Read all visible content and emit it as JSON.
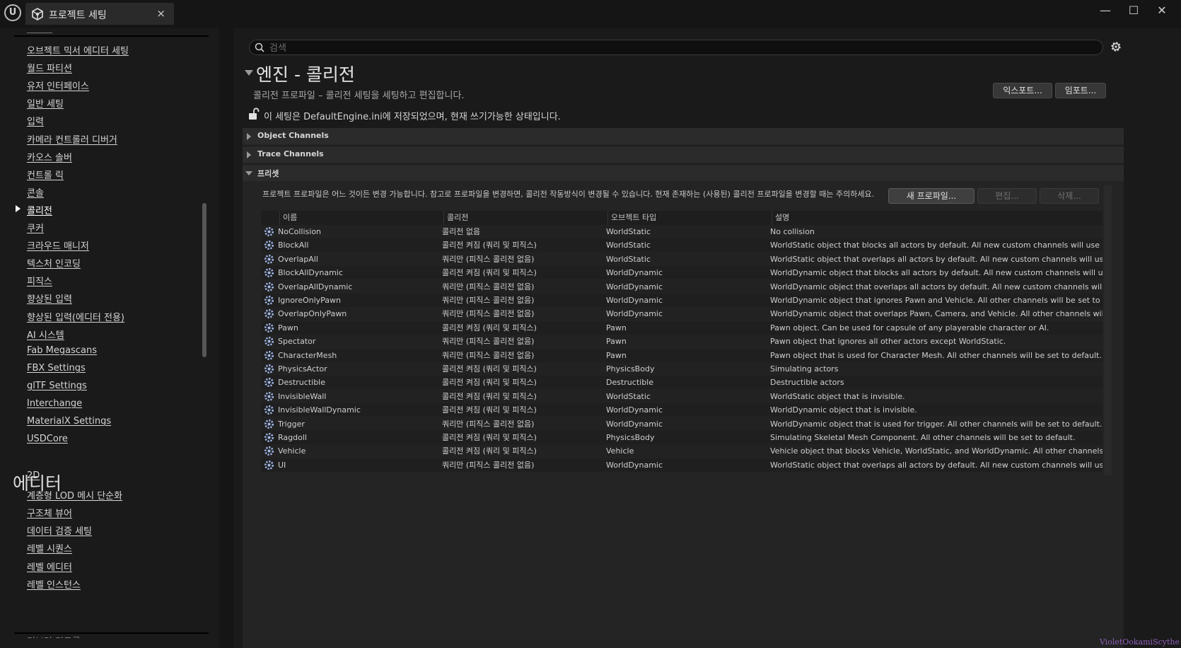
{
  "window": {
    "tab_title": "프로젝트 세팅",
    "close_glyph": "×",
    "controls": {
      "minimize": "—",
      "maximize": "☐",
      "close": "✕"
    }
  },
  "sidebar": {
    "items_top": [
      {
        "label": "오브젝트 믹서 에디터 세팅"
      },
      {
        "label": "월드 파티션"
      },
      {
        "label": "유저 인터페이스"
      },
      {
        "label": "일반 세팅"
      },
      {
        "label": "입력"
      },
      {
        "label": "카메라 컨트롤러 디버거"
      },
      {
        "label": "카오스 솔버"
      },
      {
        "label": "컨트롤 릭"
      },
      {
        "label": "콘솔"
      },
      {
        "label": "콜리전",
        "selected": true
      },
      {
        "label": "쿠커"
      },
      {
        "label": "크라우드 매니저"
      },
      {
        "label": "텍스처 인코딩"
      },
      {
        "label": "피직스"
      },
      {
        "label": "향상된 입력"
      },
      {
        "label": "향상된 입력(에디터 전용)"
      },
      {
        "label": "AI 시스템"
      },
      {
        "label": "Fab Megascans"
      },
      {
        "label": "FBX Settings"
      },
      {
        "label": "glTF Settings"
      },
      {
        "label": "Interchange"
      },
      {
        "label": "MaterialX Settings"
      },
      {
        "label": "USDCore"
      }
    ],
    "section_editor": "에디터",
    "items_editor": [
      {
        "label": "2D"
      },
      {
        "label": "계층형 LOD 메시 단순화"
      },
      {
        "label": "구조체 뷰어"
      },
      {
        "label": "데이터 검증 세팅"
      },
      {
        "label": "레벨 시퀀스"
      },
      {
        "label": "레벨 에디터"
      },
      {
        "label": "레벨 인스턴스"
      }
    ],
    "cut_item": "리브러 컨트롤"
  },
  "search": {
    "placeholder": "검색",
    "value": ""
  },
  "header": {
    "title": "엔진 - 콜리전",
    "description": "콜리전 프로파일 – 콜리전 세팅을 세팅하고 편집합니다.",
    "export_label": "익스포트...",
    "import_label": "임포트...",
    "status": "이 세팅은 DefaultEngine.ini에 저장되었으며, 현재 쓰기가능한 상태입니다."
  },
  "sections": {
    "object_channels": "Object Channels",
    "trace_channels": "Trace Channels",
    "presets": "프리셋"
  },
  "presets": {
    "description": "프로젝트 프로파일은 어느 것이든 변경 가능합니다. 참고로 프로파일을 변경하면, 콜리전 작동방식이 변경될 수 있습니다. 현재 존재하는 (사용된) 콜리전 프로파일을 변경할 때는 주의하세요.",
    "new_profile_label": "새 프로파일...",
    "edit_label": "편집...",
    "delete_label": "삭제..."
  },
  "table": {
    "columns": [
      "이름",
      "콜리전",
      "오브젝트 타입",
      "설명"
    ],
    "rows": [
      {
        "name": "NoCollision",
        "collision": "콜리전 없음",
        "type": "WorldStatic",
        "desc": "No collision"
      },
      {
        "name": "BlockAll",
        "collision": "콜리전 켜짐 (쿼리 및 피직스)",
        "type": "WorldStatic",
        "desc": "WorldStatic object that blocks all actors by default. All new custom channels will use its own default response."
      },
      {
        "name": "OverlapAll",
        "collision": "쿼리만 (피직스 콜리전 없음)",
        "type": "WorldStatic",
        "desc": "WorldStatic object that overlaps all actors by default. All new custom channels will use its own default response."
      },
      {
        "name": "BlockAllDynamic",
        "collision": "콜리전 켜짐 (쿼리 및 피직스)",
        "type": "WorldDynamic",
        "desc": "WorldDynamic object that blocks all actors by default. All new custom channels will use its own default response."
      },
      {
        "name": "OverlapAllDynamic",
        "collision": "쿼리만 (피직스 콜리전 없음)",
        "type": "WorldDynamic",
        "desc": "WorldDynamic object that overlaps all actors by default. All new custom channels will use its own default response."
      },
      {
        "name": "IgnoreOnlyPawn",
        "collision": "쿼리만 (피직스 콜리전 없음)",
        "type": "WorldDynamic",
        "desc": "WorldDynamic object that ignores Pawn and Vehicle. All other channels will be set to default."
      },
      {
        "name": "OverlapOnlyPawn",
        "collision": "쿼리만 (피직스 콜리전 없음)",
        "type": "WorldDynamic",
        "desc": "WorldDynamic object that overlaps Pawn, Camera, and Vehicle. All other channels will be set to default."
      },
      {
        "name": "Pawn",
        "collision": "콜리전 켜짐 (쿼리 및 피직스)",
        "type": "Pawn",
        "desc": "Pawn object. Can be used for capsule of any playerable character or AI."
      },
      {
        "name": "Spectator",
        "collision": "쿼리만 (피직스 콜리전 없음)",
        "type": "Pawn",
        "desc": "Pawn object that ignores all other actors except WorldStatic."
      },
      {
        "name": "CharacterMesh",
        "collision": "쿼리만 (피직스 콜리전 없음)",
        "type": "Pawn",
        "desc": "Pawn object that is used for Character Mesh. All other channels will be set to default."
      },
      {
        "name": "PhysicsActor",
        "collision": "콜리전 켜짐 (쿼리 및 피직스)",
        "type": "PhysicsBody",
        "desc": "Simulating actors"
      },
      {
        "name": "Destructible",
        "collision": "콜리전 켜짐 (쿼리 및 피직스)",
        "type": "Destructible",
        "desc": "Destructible actors"
      },
      {
        "name": "InvisibleWall",
        "collision": "콜리전 켜짐 (쿼리 및 피직스)",
        "type": "WorldStatic",
        "desc": "WorldStatic object that is invisible."
      },
      {
        "name": "InvisibleWallDynamic",
        "collision": "콜리전 켜짐 (쿼리 및 피직스)",
        "type": "WorldDynamic",
        "desc": "WorldDynamic object that is invisible."
      },
      {
        "name": "Trigger",
        "collision": "쿼리만 (피직스 콜리전 없음)",
        "type": "WorldDynamic",
        "desc": "WorldDynamic object that is used for trigger. All other channels will be set to default."
      },
      {
        "name": "Ragdoll",
        "collision": "콜리전 켜짐 (쿼리 및 피직스)",
        "type": "PhysicsBody",
        "desc": "Simulating Skeletal Mesh Component. All other channels will be set to default."
      },
      {
        "name": "Vehicle",
        "collision": "콜리전 켜짐 (쿼리 및 피직스)",
        "type": "Vehicle",
        "desc": "Vehicle object that blocks Vehicle, WorldStatic, and WorldDynamic. All other channels will be set to default."
      },
      {
        "name": "UI",
        "collision": "쿼리만 (피직스 콜리전 없음)",
        "type": "WorldDynamic",
        "desc": "WorldStatic object that overlaps all actors by default. All new custom channels will use its own default response."
      }
    ]
  },
  "watermark": "VioletOokamiScythe",
  "colors": {
    "background": "#151515",
    "panel": "#1a1a1a",
    "content": "#242424",
    "watermark": "#8d5fb8"
  },
  "icons": [
    "unreal-logo-icon",
    "settings-cube-icon",
    "search-icon",
    "gear-icon",
    "unlock-icon",
    "collision-profile-icon"
  ]
}
